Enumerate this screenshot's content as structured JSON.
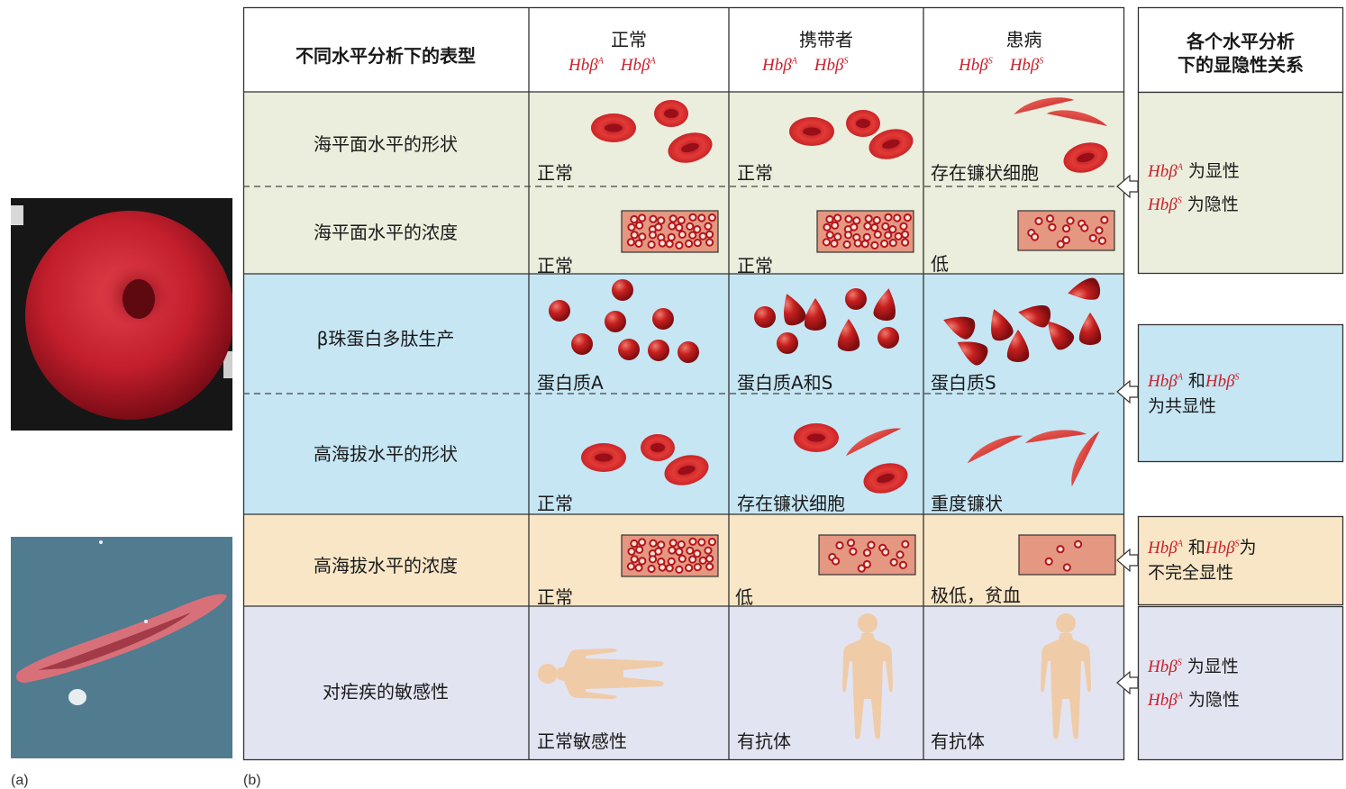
{
  "panels": {
    "a_label": "(a)",
    "b_label": "(b)"
  },
  "photos": {
    "top": "normal-red-blood-cell-micrograph",
    "bottom": "sickle-cell-micrograph"
  },
  "header": {
    "corner": "不同水平分析下的表型",
    "columns": [
      {
        "title": "正常",
        "allele1": "Hbβ",
        "sup1": "A",
        "allele2": "Hbβ",
        "sup2": "A"
      },
      {
        "title": "携带者",
        "allele1": "Hbβ",
        "sup1": "A",
        "allele2": "Hbβ",
        "sup2": "S"
      },
      {
        "title": "患病",
        "allele1": "Hbβ",
        "sup1": "S",
        "allele2": "Hbβ",
        "sup2": "S"
      }
    ],
    "relation_title_1": "各个水平分析",
    "relation_title_2": "下的显隐性关系"
  },
  "rows": [
    {
      "label": "海平面水平的形状",
      "cells": [
        "正常",
        "正常",
        "存在镰状细胞"
      ]
    },
    {
      "label": "海平面水平的浓度",
      "cells": [
        "正常",
        "正常",
        "低"
      ]
    },
    {
      "label": "β珠蛋白多肽生产",
      "cells": [
        "蛋白质A",
        "蛋白质A和S",
        "蛋白质S"
      ]
    },
    {
      "label": "高海拔水平的形状",
      "cells": [
        "正常",
        "存在镰状细胞",
        "重度镰状"
      ]
    },
    {
      "label": "高海拔水平的浓度",
      "cells": [
        "正常",
        "低",
        "极低，贫血"
      ]
    },
    {
      "label": "对疟疾的敏感性",
      "cells": [
        "正常敏感性",
        "有抗体",
        "有抗体"
      ]
    }
  ],
  "relations": {
    "r1_line1_allele": "Hbβ",
    "r1_line1_sup": "A",
    "r1_line1_text": "为显性",
    "r1_line2_allele": "Hbβ",
    "r1_line2_sup": "S",
    "r1_line2_text": "为隐性",
    "r2_allele_a": "Hbβ",
    "r2_sup_a": "A",
    "r2_and": "和",
    "r2_allele_b": "Hbβ",
    "r2_sup_b": "S",
    "r2_line2": "为共显性",
    "r3_allele_a": "Hbβ",
    "r3_sup_a": "A",
    "r3_and": "和",
    "r3_allele_b": "Hbβ",
    "r3_sup_b": "S",
    "r3_tail": "为",
    "r3_line2": "不完全显性",
    "r4_line1_allele": "Hbβ",
    "r4_line1_sup": "S",
    "r4_line1_text": "为显性",
    "r4_line2_allele": "Hbβ",
    "r4_line2_sup": "A",
    "r4_line2_text": "为隐性"
  },
  "colors": {
    "row_sea": "#eceedd",
    "row_protein": "#c6e6f4",
    "row_altitude_conc": "#f8e6c6",
    "row_malaria": "#e2e4f1",
    "cell_red": "#d42a2c",
    "box_fill": "#e49781",
    "body_tan": "#f0cba7",
    "allele_red": "#c8202a"
  }
}
